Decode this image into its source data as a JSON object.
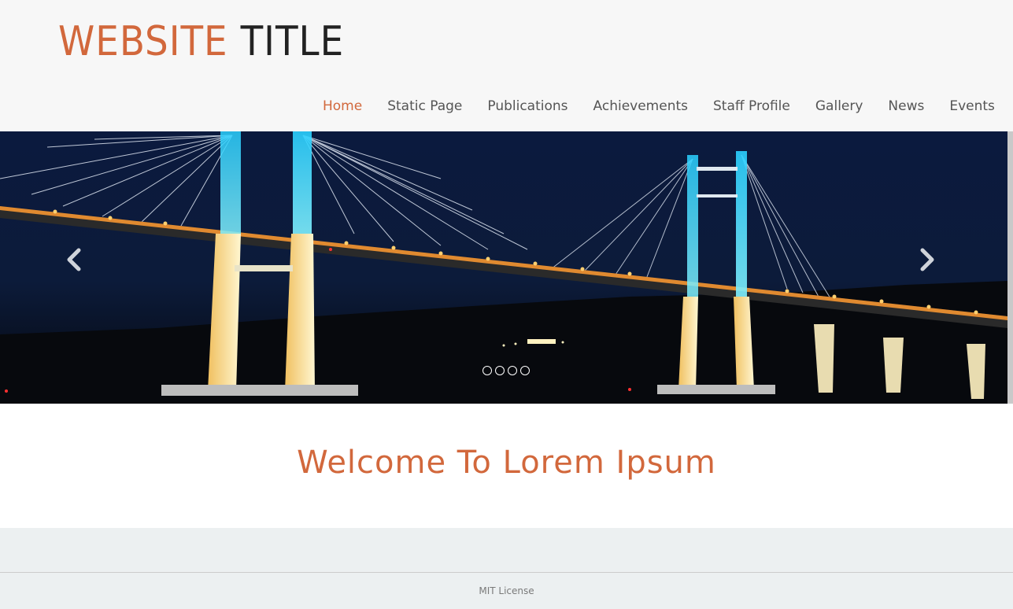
{
  "header": {
    "logo_part1": "Website",
    "logo_part2": "Title"
  },
  "nav": {
    "items": [
      {
        "label": "Home",
        "active": true
      },
      {
        "label": "Static Page"
      },
      {
        "label": "Publications"
      },
      {
        "label": "Achievements"
      },
      {
        "label": "Staff Profile"
      },
      {
        "label": "Gallery"
      },
      {
        "label": "News"
      },
      {
        "label": "Events"
      }
    ]
  },
  "carousel": {
    "slide_count": 4,
    "prev_icon": "chevron-left-icon",
    "next_icon": "chevron-right-icon",
    "image": "night cable-stayed bridge"
  },
  "welcome": {
    "title": "Welcome To Lorem Ipsum"
  },
  "footer": {
    "text": "MIT License"
  },
  "colors": {
    "accent": "#d2683c",
    "header_bg": "#f7f7f7",
    "footer_bg": "#ecf0f1",
    "nav_text": "#555555"
  }
}
